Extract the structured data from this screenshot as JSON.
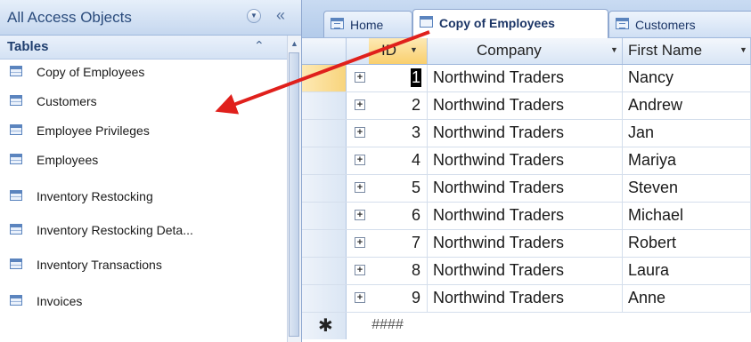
{
  "nav": {
    "title": "All Access Objects",
    "dropdown_glyph": "▼",
    "collapse_glyph": "«",
    "group": {
      "label": "Tables",
      "chevron": "⌃"
    },
    "items": [
      {
        "label": "Copy of Employees"
      },
      {
        "label": "Customers"
      },
      {
        "label": "Employee Privileges"
      },
      {
        "label": "Employees"
      },
      {
        "label": "Inventory Restocking"
      },
      {
        "label": "Inventory Restocking Deta..."
      },
      {
        "label": "Inventory Transactions"
      },
      {
        "label": "Invoices"
      }
    ]
  },
  "tabs": [
    {
      "label": "Home",
      "icon": "form-icon"
    },
    {
      "label": "Copy of Employees",
      "icon": "table-icon",
      "active": true
    },
    {
      "label": "Customers",
      "icon": "form-icon"
    }
  ],
  "grid": {
    "columns": [
      {
        "label": "ID",
        "arrow": "▼"
      },
      {
        "label": "Company",
        "arrow": "▼"
      },
      {
        "label": "First Name",
        "arrow": "▼"
      }
    ],
    "expander_glyph": "+",
    "rows": [
      {
        "id": "1",
        "company": "Northwind Traders",
        "first_name": "Nancy"
      },
      {
        "id": "2",
        "company": "Northwind Traders",
        "first_name": "Andrew"
      },
      {
        "id": "3",
        "company": "Northwind Traders",
        "first_name": "Jan"
      },
      {
        "id": "4",
        "company": "Northwind Traders",
        "first_name": "Mariya"
      },
      {
        "id": "5",
        "company": "Northwind Traders",
        "first_name": "Steven"
      },
      {
        "id": "6",
        "company": "Northwind Traders",
        "first_name": "Michael"
      },
      {
        "id": "7",
        "company": "Northwind Traders",
        "first_name": "Robert"
      },
      {
        "id": "8",
        "company": "Northwind Traders",
        "first_name": "Laura"
      },
      {
        "id": "9",
        "company": "Northwind Traders",
        "first_name": "Anne"
      }
    ],
    "new_row": {
      "marker": "✱",
      "id": "####"
    }
  },
  "colors": {
    "annotation_arrow": "#e0201c",
    "accent": "#5b84be"
  }
}
